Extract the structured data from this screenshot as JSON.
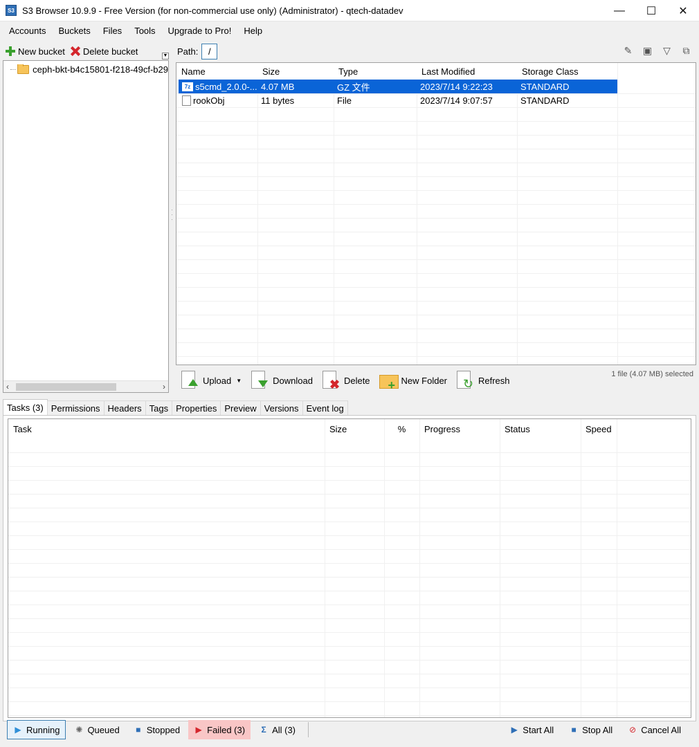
{
  "window": {
    "title": "S3 Browser 10.9.9 - Free Version (for non-commercial use only) (Administrator) - qtech-datadev",
    "app_icon_text": "S3"
  },
  "menu": [
    "Accounts",
    "Buckets",
    "Files",
    "Tools",
    "Upgrade to Pro!",
    "Help"
  ],
  "left_toolbar": {
    "new_bucket": "New bucket",
    "delete_bucket": "Delete bucket"
  },
  "tree": {
    "bucket": "ceph-bkt-b4c15801-f218-49cf-b29"
  },
  "path": {
    "label": "Path:",
    "value": "/"
  },
  "files": {
    "columns": [
      "Name",
      "Size",
      "Type",
      "Last Modified",
      "Storage Class"
    ],
    "rows": [
      {
        "name": "s5cmd_2.0.0-...",
        "size": "4.07 MB",
        "type": "GZ 文件",
        "modified": "2023/7/14 9:22:23",
        "storage": "STANDARD",
        "selected": true,
        "icon": "gz-icon",
        "icon_text": "7z"
      },
      {
        "name": "rookObj",
        "size": "11 bytes",
        "type": "File",
        "modified": "2023/7/14 9:07:57",
        "storage": "STANDARD",
        "selected": false,
        "icon": "file-icon"
      }
    ]
  },
  "actions": {
    "upload": "Upload",
    "download": "Download",
    "delete": "Delete",
    "new_folder": "New Folder",
    "refresh": "Refresh",
    "selection_status": "1 file (4.07 MB) selected"
  },
  "tabs": [
    "Tasks (3)",
    "Permissions",
    "Headers",
    "Tags",
    "Properties",
    "Preview",
    "Versions",
    "Event log"
  ],
  "tasks": {
    "columns": [
      "Task",
      "Size",
      "%",
      "Progress",
      "Status",
      "Speed"
    ]
  },
  "bottom": {
    "running": "Running",
    "queued": "Queued",
    "stopped": "Stopped",
    "failed": "Failed (3)",
    "all": "All (3)",
    "start_all": "Start All",
    "stop_all": "Stop All",
    "cancel_all": "Cancel All"
  },
  "colors": {
    "selection": "#0a64d7",
    "failed_bg": "#f9c6c6",
    "accent": "#3c7fb1"
  }
}
